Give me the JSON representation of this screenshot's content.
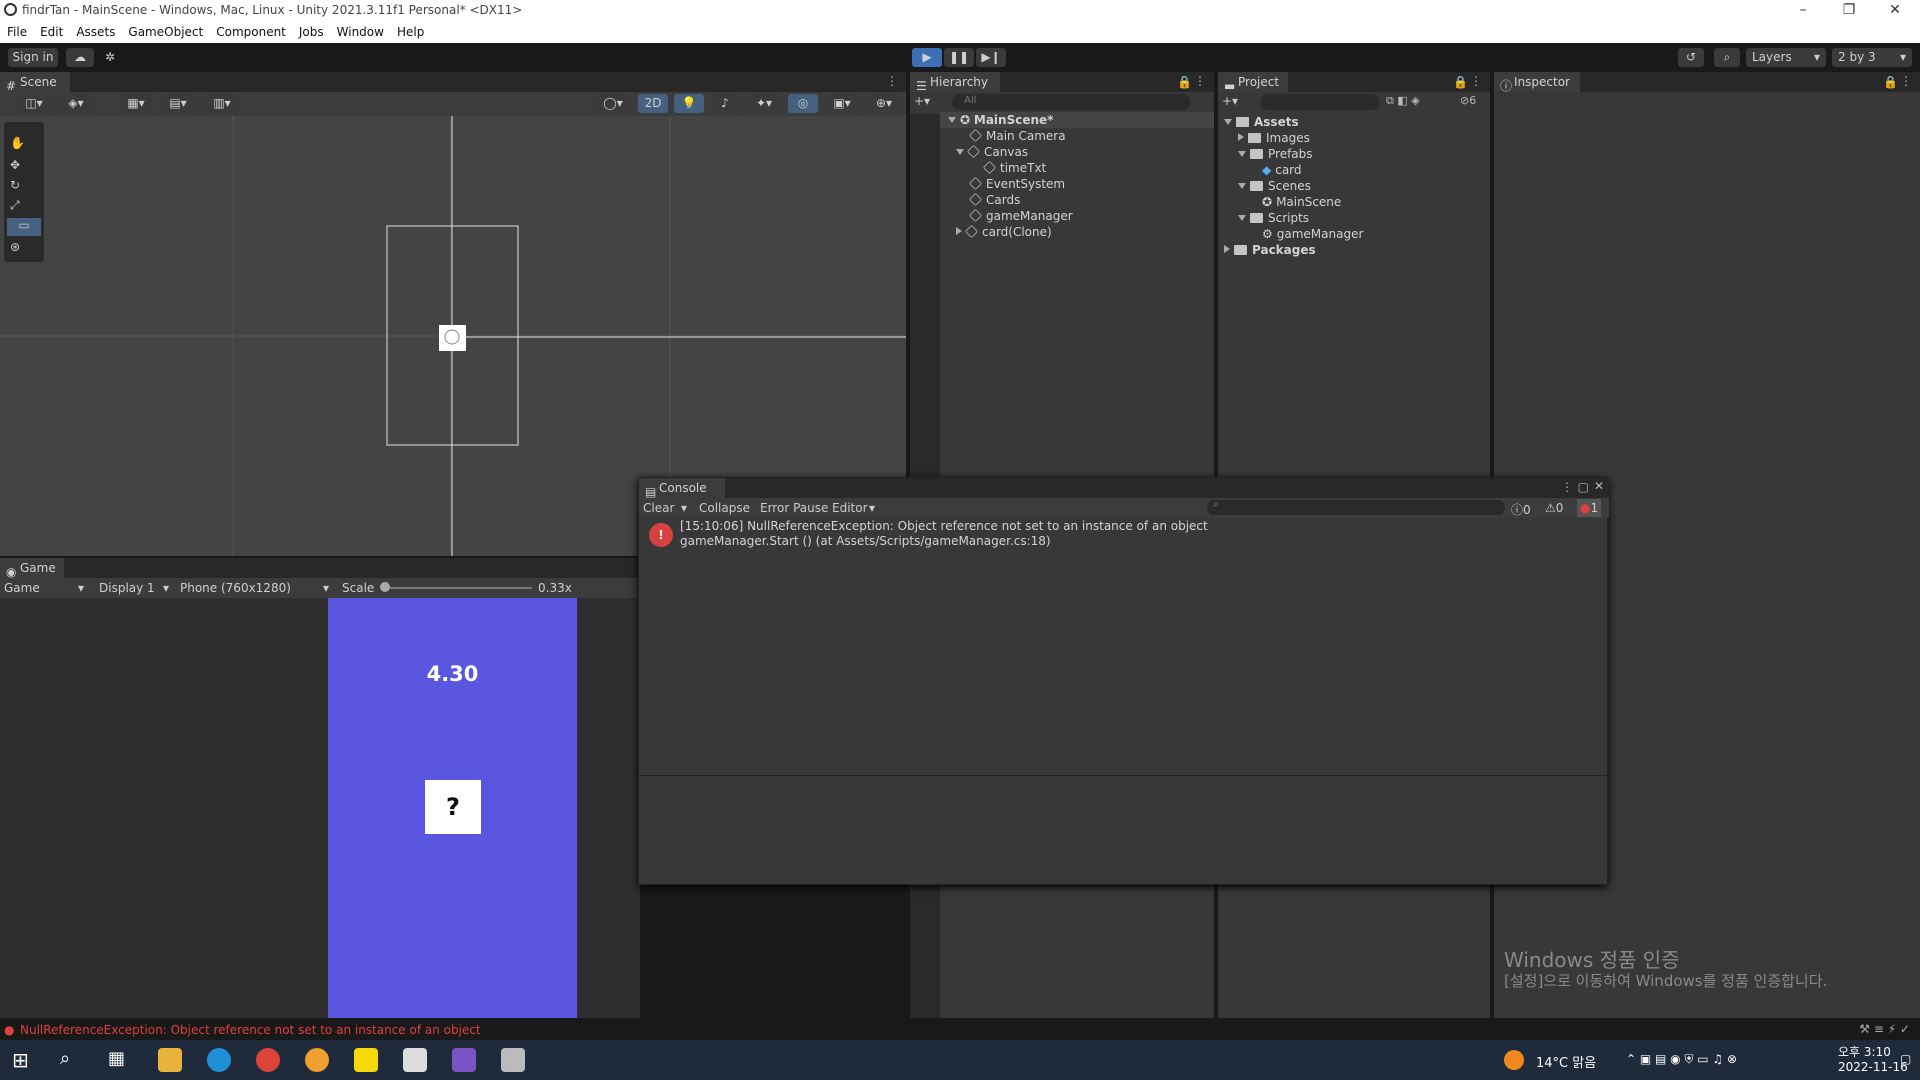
{
  "window": {
    "title": "findrTan - MainScene - Windows, Mac, Linux - Unity 2021.3.11f1 Personal* <DX11>"
  },
  "menu": [
    "File",
    "Edit",
    "Assets",
    "GameObject",
    "Component",
    "Jobs",
    "Window",
    "Help"
  ],
  "toolbar": {
    "sign_in": "Sign in",
    "layers": "Layers",
    "layout": "2 by 3"
  },
  "scene": {
    "tab": "Scene",
    "mode_2d": "2D"
  },
  "game": {
    "tab": "Game",
    "mode": "Game",
    "display": "Display 1",
    "resolution": "Phone (760x1280)",
    "scale_label": "Scale",
    "scale_value": "0.33x",
    "timer_text": "4.30",
    "card_text": "?",
    "background_color": "#5a56e0"
  },
  "hierarchy": {
    "tab": "Hierarchy",
    "search_placeholder": "All",
    "scene": "MainScene*",
    "items": [
      "Main Camera",
      "Canvas",
      "timeTxt",
      "EventSystem",
      "Cards",
      "gameManager",
      "card(Clone)"
    ]
  },
  "project": {
    "tab": "Project",
    "hidden_count": "6",
    "assets": "Assets",
    "images": "Images",
    "prefabs": "Prefabs",
    "card": "card",
    "scenes": "Scenes",
    "mainscene": "MainScene",
    "scripts": "Scripts",
    "gamemanager": "gameManager",
    "packages": "Packages"
  },
  "inspector": {
    "tab": "Inspector"
  },
  "console": {
    "tab": "Console",
    "clear": "Clear",
    "collapse": "Collapse",
    "error_pause": "Error Pause",
    "editor": "Editor",
    "log_count": "0",
    "warn_count": "0",
    "error_count": "1",
    "error_line1": "[15:10:06] NullReferenceException: Object reference not set to an instance of an object",
    "error_line2": "gameManager.Start () (at Assets/Scripts/gameManager.cs:18)"
  },
  "status_bar": {
    "message": "NullReferenceException: Object reference not set to an instance of an object"
  },
  "watermark": {
    "line1": "Windows 정품 인증",
    "line2": "[설정]으로 이동하여 Windows를 정품 인증합니다."
  },
  "taskbar": {
    "weather": "14°C 맑음",
    "time": "오후 3:10",
    "date": "2022-11-16"
  }
}
